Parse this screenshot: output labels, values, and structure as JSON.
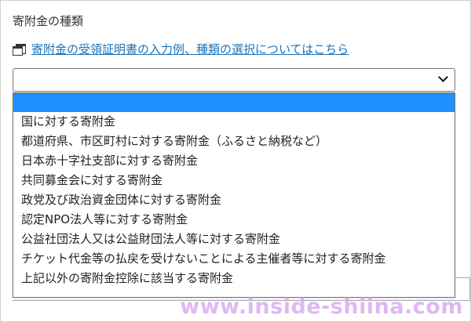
{
  "form": {
    "field_label": "寄附金の種類",
    "help_link": "寄附金の受領証明書の入力例、種類の選択についてはこちら",
    "help_icon": "window-icon",
    "select": {
      "selected_value": "",
      "icon": "chevron-down-icon",
      "options": [
        "",
        "国に対する寄附金",
        "都道府県、市区町村に対する寄附金（ふるさと納税など）",
        "日本赤十字社支部に対する寄附金",
        "共同募金会に対する寄附金",
        "政党及び政治資金団体に対する寄附金",
        "認定NPO法人等に対する寄附金",
        "公益社団法人又は公益財団法人等に対する寄附金",
        "チケット代金等の払戻を受けないことによる主催者等に対する寄附金",
        "上記以外の寄附金控除に該当する寄附金"
      ]
    }
  },
  "watermark": "www.inside-shiina.com",
  "colors": {
    "link": "#1a73b8",
    "selected_option": "#1e90ff",
    "watermark": "#d9a6f0"
  }
}
